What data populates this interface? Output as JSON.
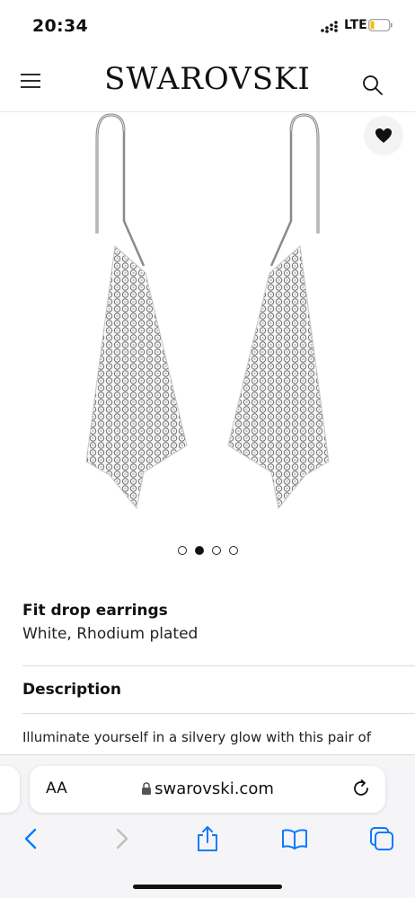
{
  "status_bar": {
    "time": "20:34",
    "network": "LTE"
  },
  "header": {
    "logo": "SWAROVSKI"
  },
  "product": {
    "title": "Fit drop earrings",
    "variant": "White, Rhodium plated",
    "gallery": {
      "total_images": 4,
      "active_index": 1
    }
  },
  "description": {
    "heading": "Description",
    "text": "Illuminate yourself in a silvery glow with this pair of"
  },
  "browser": {
    "text_size_label": "AA",
    "domain": "swarovski.com"
  },
  "icons": {
    "menu": "hamburger-menu-icon",
    "search": "search-icon",
    "wishlist": "heart-icon",
    "lock": "lock-icon",
    "reload": "reload-icon",
    "back": "chevron-left-icon",
    "forward": "chevron-right-icon",
    "share": "share-icon",
    "bookmarks": "book-icon",
    "tabs": "tabs-icon"
  },
  "colors": {
    "accent": "#0a7aff",
    "text": "#111111",
    "disabled": "#bfbfbf"
  }
}
